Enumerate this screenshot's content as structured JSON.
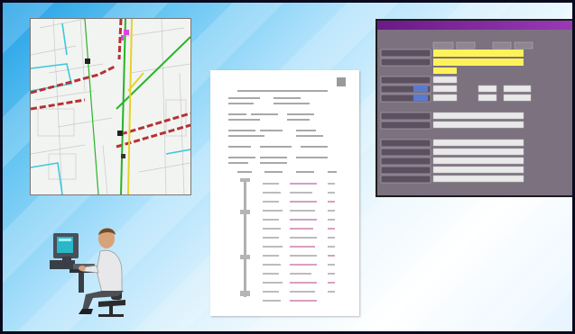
{
  "slide": {
    "background_gradient": [
      "#1e9ee6",
      "#aee1fb",
      "#ffffff"
    ],
    "border_color": "#0a0a1e"
  },
  "map_image": {
    "icons": [
      "street-map-thumbnail"
    ],
    "line_colors": [
      "#28b428",
      "#c83232",
      "#e6d228",
      "#3cc8dc",
      "#c864c8"
    ]
  },
  "document_image": {
    "icons": [
      "printed-report-page"
    ]
  },
  "form_window": {
    "icons": [
      "data-entry-form"
    ],
    "titlebar_color": "#6a1a86",
    "highlight_color": "#fdf25a"
  },
  "person": {
    "icons": [
      "person-at-computer"
    ]
  }
}
